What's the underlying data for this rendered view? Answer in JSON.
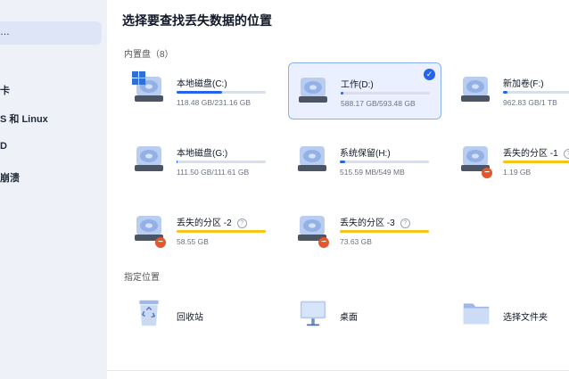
{
  "sidebar": {
    "items": [
      {
        "label": "…"
      },
      {
        "label": "卡"
      },
      {
        "label": "S 和 Linux"
      },
      {
        "label": "D"
      },
      {
        "label": "崩溃"
      }
    ]
  },
  "header": {
    "title": "选择要查找丢失数据的位置",
    "refresh_icon": "refresh-icon"
  },
  "sections": {
    "internal": "内置盘（8）",
    "specified": "指定位置"
  },
  "drives": [
    {
      "name": "本地磁盘(C:)",
      "size": "118.48 GB/231.16 GB",
      "usage": 0.51,
      "color": "#2563eb",
      "windows": true
    },
    {
      "name": "工作(D:)",
      "size": "588.17 GB/593.48 GB",
      "usage": 0.03,
      "color": "#2563eb",
      "selected": true
    },
    {
      "name": "新加卷(F:)",
      "size": "962.83 GB/1 TB",
      "usage": 0.05,
      "color": "#2563eb"
    },
    {
      "name": "本地磁盘(G:)",
      "size": "111.50 GB/111.61 GB",
      "usage": 0.01,
      "color": "#2563eb"
    },
    {
      "name": "系统保留(H:)",
      "size": "515.59 MB/549 MB",
      "usage": 0.06,
      "color": "#2563eb"
    },
    {
      "name": "丢失的分区 -1",
      "size": "1.19 GB",
      "usage": 1.0,
      "color": "#f5c518",
      "lost": true
    },
    {
      "name": "丢失的分区 -2",
      "size": "58.55 GB",
      "usage": 1.0,
      "color": "#f5c518",
      "lost": true
    },
    {
      "name": "丢失的分区 -3",
      "size": "73.63 GB",
      "usage": 1.0,
      "color": "#f5c518",
      "lost": true
    }
  ],
  "locations": [
    {
      "label": "回收站",
      "icon": "recycle-bin-icon"
    },
    {
      "label": "桌面",
      "icon": "desktop-icon"
    },
    {
      "label": "选择文件夹",
      "icon": "folder-icon"
    }
  ]
}
